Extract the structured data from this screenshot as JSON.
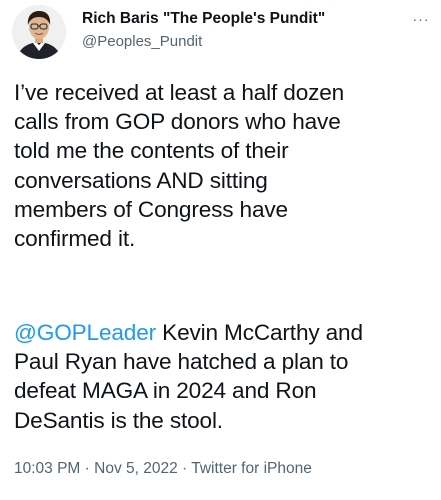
{
  "tweet": {
    "author": {
      "display_name": "Rich Baris \"The People's Pundit\"",
      "handle": "@Peoples_Pundit"
    },
    "more_label": "···",
    "paragraph1": {
      "lines": [
        "I’ve received at least a half dozen",
        "calls from GOP donors who have",
        "told me the contents of their",
        "conversations AND sitting",
        "members of Congress have",
        "confirmed it."
      ]
    },
    "paragraph2": {
      "mention": "@GOPLeader",
      "line1_rest": " Kevin McCarthy and",
      "lines": [
        "Paul Ryan have hatched a plan to",
        "defeat MAGA in 2024 and Ron",
        "DeSantis is the stool."
      ]
    },
    "meta": {
      "time": "10:03 PM",
      "sep1": " · ",
      "date": "Nov 5, 2022",
      "sep2": " · ",
      "source": "Twitter for iPhone"
    },
    "colors": {
      "mention": "#1d9bf0",
      "secondary_text": "#536471",
      "primary_text": "#0f1419"
    }
  }
}
